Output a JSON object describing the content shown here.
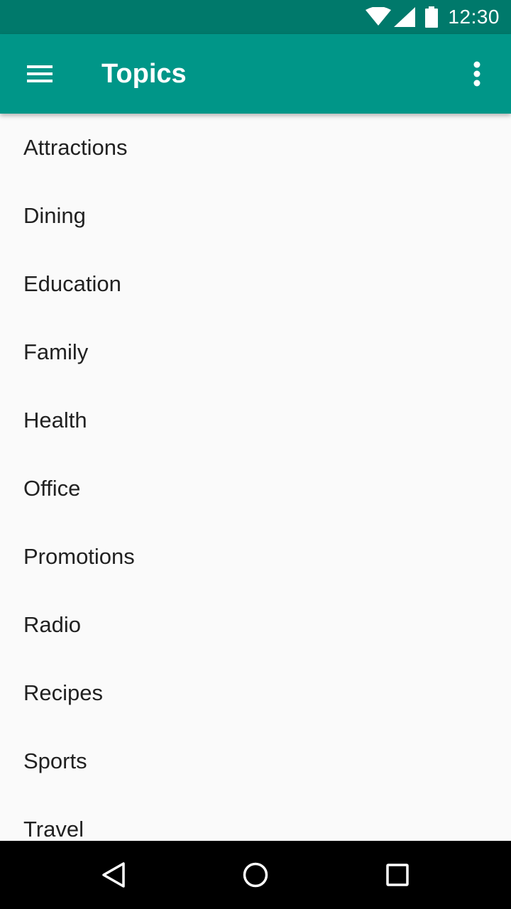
{
  "status_bar": {
    "time": "12:30",
    "icons": [
      "wifi-icon",
      "signal-icon",
      "battery-icon"
    ]
  },
  "app_bar": {
    "title": "Topics",
    "left_icon": "menu-icon",
    "right_icon": "more-vert-icon"
  },
  "topics": [
    "Attractions",
    "Dining",
    "Education",
    "Family",
    "Health",
    "Office",
    "Promotions",
    "Radio",
    "Recipes",
    "Sports",
    "Travel"
  ],
  "nav_bar": {
    "icons": [
      "back-icon",
      "home-icon",
      "recents-icon"
    ]
  },
  "colors": {
    "status_bar": "#00796b",
    "app_bar": "#009688",
    "background": "#fafafa",
    "text": "#212121",
    "nav_bar": "#000000"
  }
}
